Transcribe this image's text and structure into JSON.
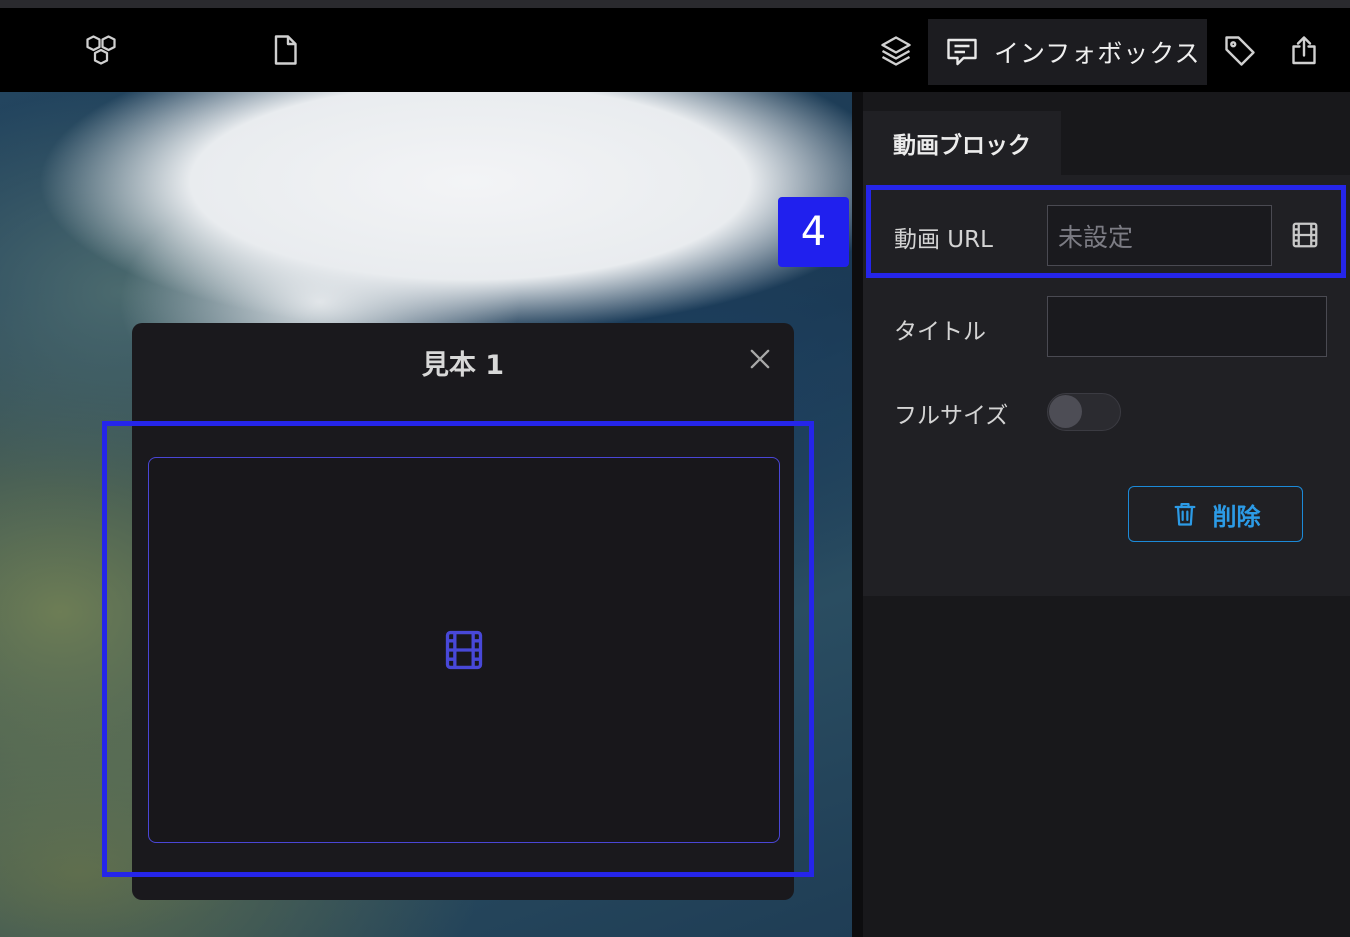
{
  "toolbar": {
    "left_icons": [
      "blocks-icon",
      "document-icon"
    ],
    "right_icons": [
      "layers-icon",
      "tag-icon",
      "export-icon"
    ],
    "active_tab": {
      "icon": "message-square-icon",
      "label": "インフォボックス"
    }
  },
  "map": {
    "step_marker": "4"
  },
  "popup": {
    "title": "見本 1",
    "close_icon": "close-icon",
    "video_block_icon": "film-icon"
  },
  "panel": {
    "tab_label": "動画ブロック",
    "fields": {
      "video_url": {
        "label": "動画 URL",
        "placeholder": "未設定",
        "value": "",
        "icon": "film-icon"
      },
      "title": {
        "label": "タイトル",
        "value": ""
      },
      "full_size": {
        "label": "フルサイズ",
        "checked": false
      }
    },
    "delete_button": {
      "label": "削除",
      "icon": "trash-icon"
    }
  },
  "colors": {
    "highlight": "#2525ea",
    "accent_blue": "#2c9be6",
    "panel_bg": "#202024",
    "popup_bg": "#1a191d"
  }
}
